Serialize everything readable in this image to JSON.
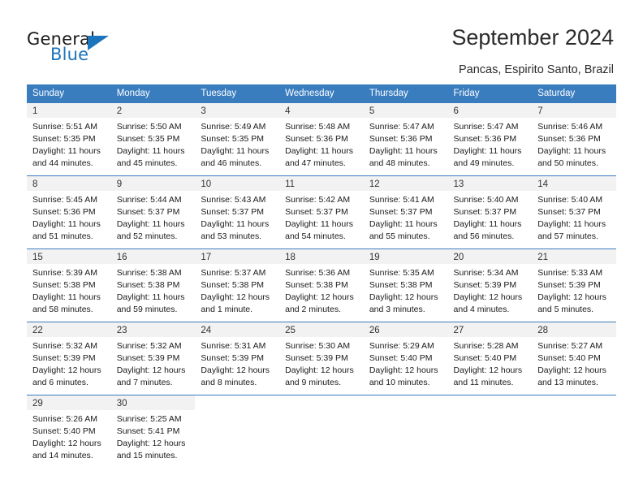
{
  "logo": {
    "word_top": "General",
    "word_bottom": "Blue",
    "accent_color": "#1c74bc",
    "triangle_icon": "triangle-icon"
  },
  "header": {
    "title": "September 2024",
    "subtitle": "Pancas, Espirito Santo, Brazil"
  },
  "calendar": {
    "header_bg": "#3a7dbf",
    "daynum_bg": "#f2f2f2",
    "weekday_headers": [
      "Sunday",
      "Monday",
      "Tuesday",
      "Wednesday",
      "Thursday",
      "Friday",
      "Saturday"
    ],
    "weeks": [
      [
        {
          "day": "1",
          "sunrise": "Sunrise: 5:51 AM",
          "sunset": "Sunset: 5:35 PM",
          "daylight_1": "Daylight: 11 hours",
          "daylight_2": "and 44 minutes."
        },
        {
          "day": "2",
          "sunrise": "Sunrise: 5:50 AM",
          "sunset": "Sunset: 5:35 PM",
          "daylight_1": "Daylight: 11 hours",
          "daylight_2": "and 45 minutes."
        },
        {
          "day": "3",
          "sunrise": "Sunrise: 5:49 AM",
          "sunset": "Sunset: 5:35 PM",
          "daylight_1": "Daylight: 11 hours",
          "daylight_2": "and 46 minutes."
        },
        {
          "day": "4",
          "sunrise": "Sunrise: 5:48 AM",
          "sunset": "Sunset: 5:36 PM",
          "daylight_1": "Daylight: 11 hours",
          "daylight_2": "and 47 minutes."
        },
        {
          "day": "5",
          "sunrise": "Sunrise: 5:47 AM",
          "sunset": "Sunset: 5:36 PM",
          "daylight_1": "Daylight: 11 hours",
          "daylight_2": "and 48 minutes."
        },
        {
          "day": "6",
          "sunrise": "Sunrise: 5:47 AM",
          "sunset": "Sunset: 5:36 PM",
          "daylight_1": "Daylight: 11 hours",
          "daylight_2": "and 49 minutes."
        },
        {
          "day": "7",
          "sunrise": "Sunrise: 5:46 AM",
          "sunset": "Sunset: 5:36 PM",
          "daylight_1": "Daylight: 11 hours",
          "daylight_2": "and 50 minutes."
        }
      ],
      [
        {
          "day": "8",
          "sunrise": "Sunrise: 5:45 AM",
          "sunset": "Sunset: 5:36 PM",
          "daylight_1": "Daylight: 11 hours",
          "daylight_2": "and 51 minutes."
        },
        {
          "day": "9",
          "sunrise": "Sunrise: 5:44 AM",
          "sunset": "Sunset: 5:37 PM",
          "daylight_1": "Daylight: 11 hours",
          "daylight_2": "and 52 minutes."
        },
        {
          "day": "10",
          "sunrise": "Sunrise: 5:43 AM",
          "sunset": "Sunset: 5:37 PM",
          "daylight_1": "Daylight: 11 hours",
          "daylight_2": "and 53 minutes."
        },
        {
          "day": "11",
          "sunrise": "Sunrise: 5:42 AM",
          "sunset": "Sunset: 5:37 PM",
          "daylight_1": "Daylight: 11 hours",
          "daylight_2": "and 54 minutes."
        },
        {
          "day": "12",
          "sunrise": "Sunrise: 5:41 AM",
          "sunset": "Sunset: 5:37 PM",
          "daylight_1": "Daylight: 11 hours",
          "daylight_2": "and 55 minutes."
        },
        {
          "day": "13",
          "sunrise": "Sunrise: 5:40 AM",
          "sunset": "Sunset: 5:37 PM",
          "daylight_1": "Daylight: 11 hours",
          "daylight_2": "and 56 minutes."
        },
        {
          "day": "14",
          "sunrise": "Sunrise: 5:40 AM",
          "sunset": "Sunset: 5:37 PM",
          "daylight_1": "Daylight: 11 hours",
          "daylight_2": "and 57 minutes."
        }
      ],
      [
        {
          "day": "15",
          "sunrise": "Sunrise: 5:39 AM",
          "sunset": "Sunset: 5:38 PM",
          "daylight_1": "Daylight: 11 hours",
          "daylight_2": "and 58 minutes."
        },
        {
          "day": "16",
          "sunrise": "Sunrise: 5:38 AM",
          "sunset": "Sunset: 5:38 PM",
          "daylight_1": "Daylight: 11 hours",
          "daylight_2": "and 59 minutes."
        },
        {
          "day": "17",
          "sunrise": "Sunrise: 5:37 AM",
          "sunset": "Sunset: 5:38 PM",
          "daylight_1": "Daylight: 12 hours",
          "daylight_2": "and 1 minute."
        },
        {
          "day": "18",
          "sunrise": "Sunrise: 5:36 AM",
          "sunset": "Sunset: 5:38 PM",
          "daylight_1": "Daylight: 12 hours",
          "daylight_2": "and 2 minutes."
        },
        {
          "day": "19",
          "sunrise": "Sunrise: 5:35 AM",
          "sunset": "Sunset: 5:38 PM",
          "daylight_1": "Daylight: 12 hours",
          "daylight_2": "and 3 minutes."
        },
        {
          "day": "20",
          "sunrise": "Sunrise: 5:34 AM",
          "sunset": "Sunset: 5:39 PM",
          "daylight_1": "Daylight: 12 hours",
          "daylight_2": "and 4 minutes."
        },
        {
          "day": "21",
          "sunrise": "Sunrise: 5:33 AM",
          "sunset": "Sunset: 5:39 PM",
          "daylight_1": "Daylight: 12 hours",
          "daylight_2": "and 5 minutes."
        }
      ],
      [
        {
          "day": "22",
          "sunrise": "Sunrise: 5:32 AM",
          "sunset": "Sunset: 5:39 PM",
          "daylight_1": "Daylight: 12 hours",
          "daylight_2": "and 6 minutes."
        },
        {
          "day": "23",
          "sunrise": "Sunrise: 5:32 AM",
          "sunset": "Sunset: 5:39 PM",
          "daylight_1": "Daylight: 12 hours",
          "daylight_2": "and 7 minutes."
        },
        {
          "day": "24",
          "sunrise": "Sunrise: 5:31 AM",
          "sunset": "Sunset: 5:39 PM",
          "daylight_1": "Daylight: 12 hours",
          "daylight_2": "and 8 minutes."
        },
        {
          "day": "25",
          "sunrise": "Sunrise: 5:30 AM",
          "sunset": "Sunset: 5:39 PM",
          "daylight_1": "Daylight: 12 hours",
          "daylight_2": "and 9 minutes."
        },
        {
          "day": "26",
          "sunrise": "Sunrise: 5:29 AM",
          "sunset": "Sunset: 5:40 PM",
          "daylight_1": "Daylight: 12 hours",
          "daylight_2": "and 10 minutes."
        },
        {
          "day": "27",
          "sunrise": "Sunrise: 5:28 AM",
          "sunset": "Sunset: 5:40 PM",
          "daylight_1": "Daylight: 12 hours",
          "daylight_2": "and 11 minutes."
        },
        {
          "day": "28",
          "sunrise": "Sunrise: 5:27 AM",
          "sunset": "Sunset: 5:40 PM",
          "daylight_1": "Daylight: 12 hours",
          "daylight_2": "and 13 minutes."
        }
      ],
      [
        {
          "day": "29",
          "sunrise": "Sunrise: 5:26 AM",
          "sunset": "Sunset: 5:40 PM",
          "daylight_1": "Daylight: 12 hours",
          "daylight_2": "and 14 minutes."
        },
        {
          "day": "30",
          "sunrise": "Sunrise: 5:25 AM",
          "sunset": "Sunset: 5:41 PM",
          "daylight_1": "Daylight: 12 hours",
          "daylight_2": "and 15 minutes."
        },
        null,
        null,
        null,
        null,
        null
      ]
    ]
  }
}
